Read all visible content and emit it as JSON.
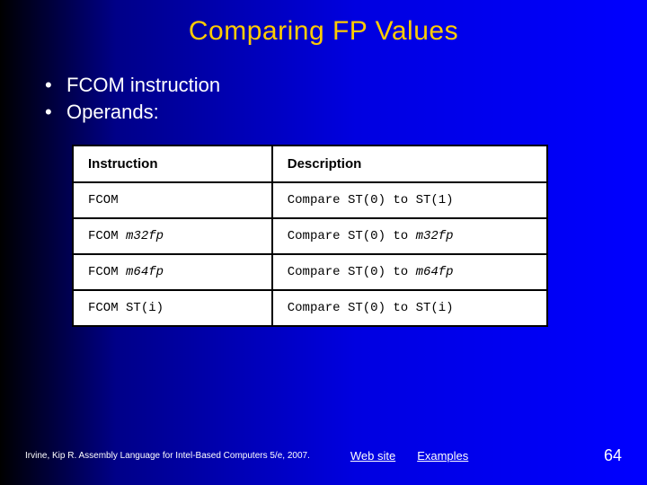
{
  "title": "Comparing FP Values",
  "bullets": {
    "b1": "FCOM instruction",
    "b2": "Operands:"
  },
  "table": {
    "headers": {
      "h1": "Instruction",
      "h2": "Description"
    },
    "rows": [
      {
        "inst": "FCOM",
        "arg": "",
        "desc": "Compare ST(0) to ST(1)"
      },
      {
        "inst": "FCOM",
        "arg": "m32fp",
        "desc_pre": "Compare ST(0) to ",
        "desc_arg": "m32fp"
      },
      {
        "inst": "FCOM",
        "arg": "m64fp",
        "desc_pre": "Compare ST(0) to ",
        "desc_arg": "m64fp"
      },
      {
        "inst": "FCOM",
        "arg": "ST(i)",
        "desc": "Compare ST(0) to ST(i)"
      }
    ]
  },
  "footer": {
    "cite": "Irvine, Kip R. Assembly Language for Intel-Based Computers 5/e, 2007.",
    "link1": "Web site",
    "link2": "Examples",
    "pagenum": "64"
  }
}
